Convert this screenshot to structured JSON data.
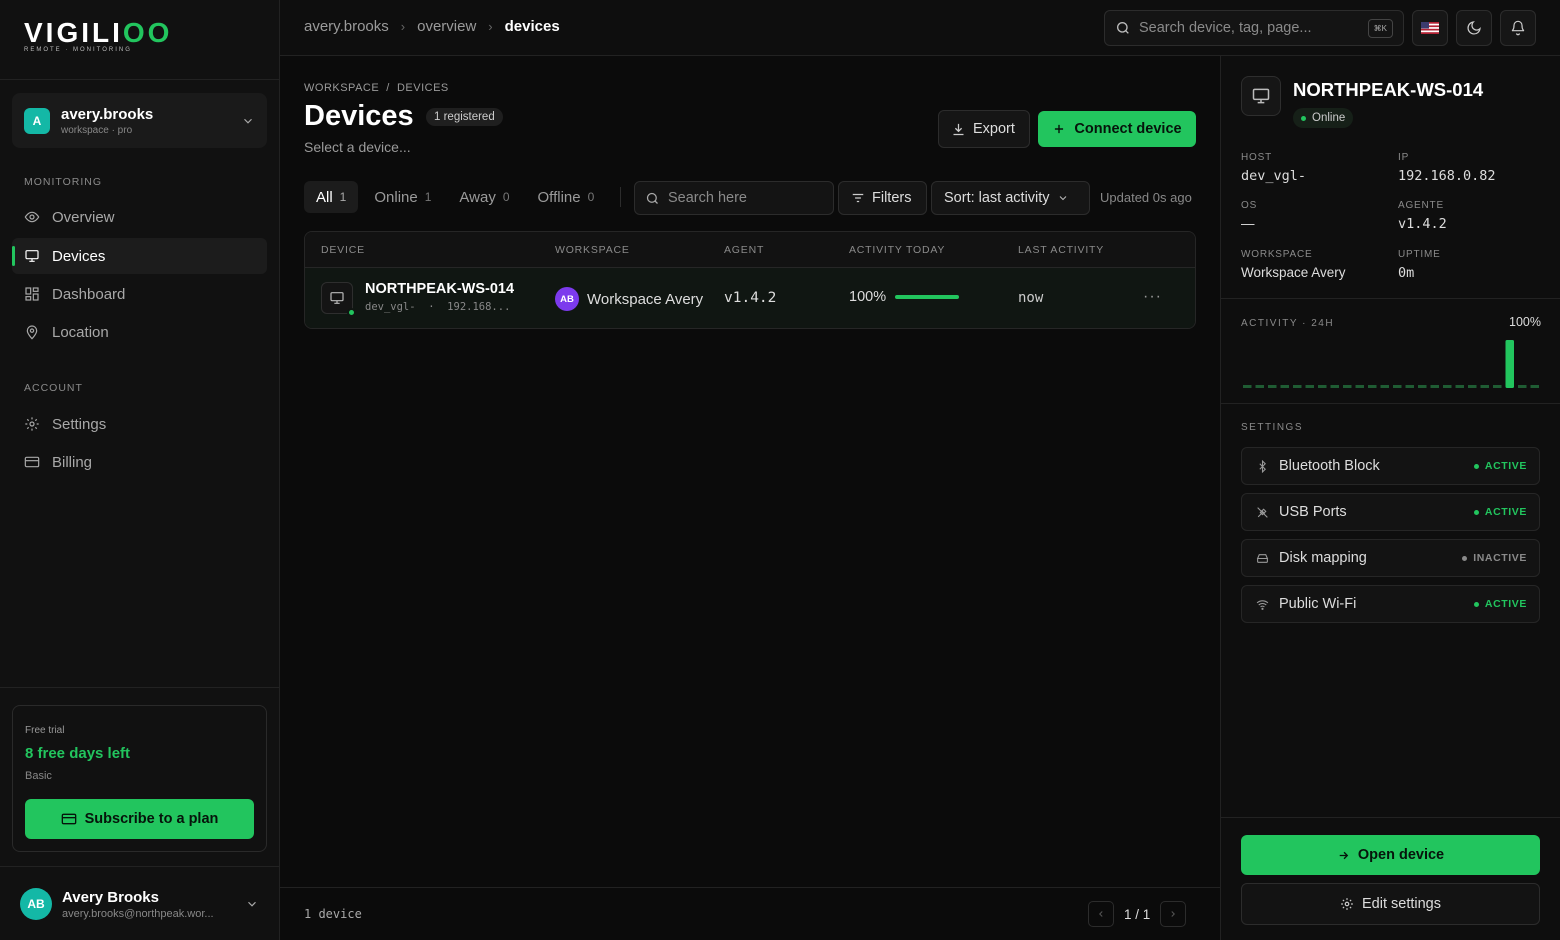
{
  "brand": {
    "logo_main": "VIGILI",
    "logo_accent": "OO",
    "tagline": "REMOTE · MONITORING"
  },
  "workspace_switcher": {
    "avatar_letter": "A",
    "name": "avery.brooks",
    "subtitle": "workspace · pro"
  },
  "sidebar": {
    "monitoring_label": "MONITORING",
    "monitoring_items": [
      {
        "label": "Overview",
        "icon": "eye-icon",
        "active": false
      },
      {
        "label": "Devices",
        "icon": "monitor-icon",
        "active": true
      },
      {
        "label": "Dashboard",
        "icon": "grid-icon",
        "active": false
      },
      {
        "label": "Location",
        "icon": "map-pin-icon",
        "active": false
      }
    ],
    "account_label": "ACCOUNT",
    "account_items": [
      {
        "label": "Settings",
        "icon": "gear-icon"
      },
      {
        "label": "Billing",
        "icon": "credit-card-icon"
      }
    ]
  },
  "trial": {
    "label": "Free trial",
    "days_left": "8 free days left",
    "plan": "Basic",
    "subscribe_label": "Subscribe to a plan"
  },
  "user": {
    "initials": "AB",
    "name": "Avery Brooks",
    "email": "avery.brooks@northpeak.wor..."
  },
  "topbar": {
    "breadcrumb": [
      "avery.brooks",
      "overview",
      "devices"
    ],
    "search_placeholder": "Search device, tag, page...",
    "shortcut": "⌘K"
  },
  "page": {
    "crumb": "WORKSPACE  /  DEVICES",
    "title": "Devices",
    "badge": "1 registered",
    "subtitle": "Select a device...",
    "export_label": "Export",
    "connect_label": "Connect device"
  },
  "filters": {
    "tabs": [
      {
        "label": "All",
        "count": "1",
        "active": true
      },
      {
        "label": "Online",
        "count": "1",
        "active": false
      },
      {
        "label": "Away",
        "count": "0",
        "active": false
      },
      {
        "label": "Offline",
        "count": "0",
        "active": false
      }
    ],
    "search_placeholder": "Search here",
    "filters_label": "Filters",
    "sort_label": "Sort: last activity",
    "updated": "Updated 0s ago"
  },
  "table": {
    "columns": [
      "DEVICE",
      "WORKSPACE",
      "AGENT",
      "ACTIVITY TODAY",
      "LAST ACTIVITY"
    ],
    "rows": [
      {
        "name": "NORTHPEAK-WS-014",
        "meta": "dev_vgl-  ·  192.168...",
        "workspace_initials": "AB",
        "workspace": "Workspace Avery",
        "agent": "v1.4.2",
        "activity": "100%",
        "activity_fraction": 1.0,
        "last_activity": "now",
        "status": "online"
      }
    ]
  },
  "footer": {
    "count": "1 device",
    "page": "1 / 1"
  },
  "panel": {
    "title": "NORTHPEAK-WS-014",
    "status": "Online",
    "fields": {
      "host_label": "HOST",
      "host": "dev_vgl-",
      "ip_label": "IP",
      "ip": "192.168.0.82",
      "os_label": "OS",
      "os": "—",
      "agent_label": "AGENTE",
      "agent": "v1.4.2",
      "workspace_label": "WORKSPACE",
      "workspace": "Workspace Avery",
      "uptime_label": "UPTIME",
      "uptime": "0m"
    },
    "activity_label": "ACTIVITY · 24H",
    "activity_pct": "100%",
    "activity_24h": [
      0,
      0,
      0,
      0,
      0,
      0,
      0,
      0,
      0,
      0,
      0,
      0,
      0,
      0,
      0,
      0,
      0,
      0,
      0,
      0,
      0,
      1,
      0,
      0
    ],
    "settings_label": "SETTINGS",
    "settings": [
      {
        "name": "Bluetooth Block",
        "icon": "bluetooth-icon",
        "status": "ACTIVE",
        "on": true
      },
      {
        "name": "USB Ports",
        "icon": "usb-icon",
        "status": "ACTIVE",
        "on": true
      },
      {
        "name": "Disk mapping",
        "icon": "hard-drive-icon",
        "status": "INACTIVE",
        "on": false
      },
      {
        "name": "Public Wi-Fi",
        "icon": "wifi-icon",
        "status": "ACTIVE",
        "on": true
      }
    ],
    "open_label": "Open device",
    "edit_label": "Edit settings"
  },
  "colors": {
    "accent": "#22c55e",
    "background": "#0b0b0b",
    "workspace_avatar": "#7c3aed",
    "teal": "#14b8a6"
  }
}
